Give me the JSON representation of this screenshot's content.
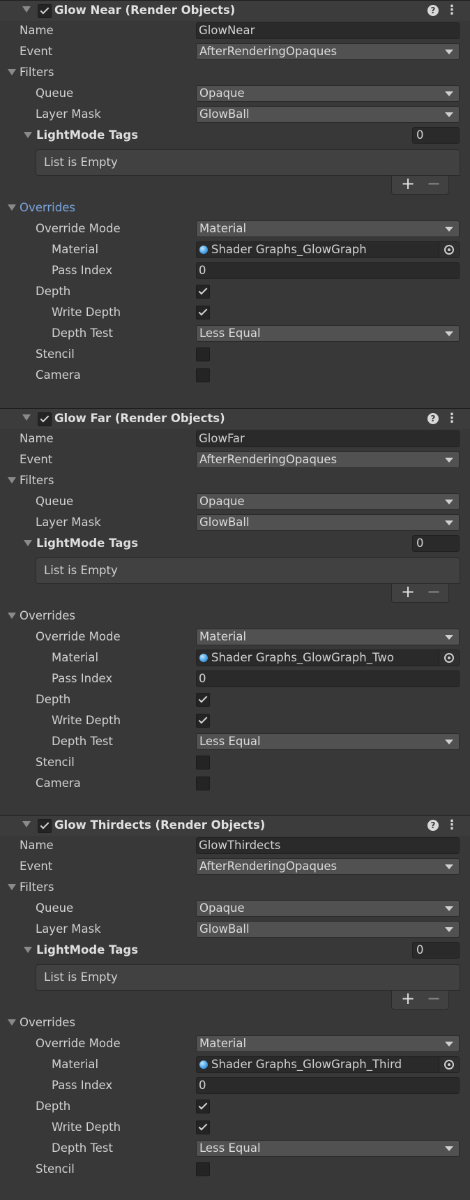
{
  "labels": {
    "name": "Name",
    "event": "Event",
    "filters": "Filters",
    "queue": "Queue",
    "layer_mask": "Layer Mask",
    "lightmode_tags": "LightMode Tags",
    "list_empty": "List is Empty",
    "overrides": "Overrides",
    "override_mode": "Override Mode",
    "material": "Material",
    "pass_index": "Pass Index",
    "depth": "Depth",
    "write_depth": "Write Depth",
    "depth_test": "Depth Test",
    "stencil": "Stencil",
    "camera": "Camera",
    "add_symbol": "+",
    "remove_symbol": "−",
    "help_symbol": "?",
    "menu_symbol": "⋮"
  },
  "components": [
    {
      "title": "Glow Near (Render Objects)",
      "enabled": true,
      "name": "GlowNear",
      "event": "AfterRenderingOpaques",
      "queue": "Opaque",
      "layer_mask": "GlowBall",
      "lightmode_count": "0",
      "override_mode": "Material",
      "material": "Shader Graphs_GlowGraph",
      "pass_index": "0",
      "depth": true,
      "write_depth": true,
      "depth_test": "Less Equal",
      "stencil": false,
      "camera": false
    },
    {
      "title": "Glow Far (Render Objects)",
      "enabled": true,
      "name": "GlowFar",
      "event": "AfterRenderingOpaques",
      "queue": "Opaque",
      "layer_mask": "GlowBall",
      "lightmode_count": "0",
      "override_mode": "Material",
      "material": "Shader Graphs_GlowGraph_Two",
      "pass_index": "0",
      "depth": true,
      "write_depth": true,
      "depth_test": "Less Equal",
      "stencil": false,
      "camera": false
    },
    {
      "title": "Glow Thirdects (Render Objects)",
      "enabled": true,
      "name": "GlowThirdects",
      "event": "AfterRenderingOpaques",
      "queue": "Opaque",
      "layer_mask": "GlowBall",
      "lightmode_count": "0",
      "override_mode": "Material",
      "material": "Shader Graphs_GlowGraph_Third",
      "pass_index": "0",
      "depth": true,
      "write_depth": true,
      "depth_test": "Less Equal",
      "stencil": false
    }
  ],
  "colors": {
    "background": "#383838",
    "overrides_link": "#7ba4de",
    "material_icon": "#4aa3e8"
  }
}
